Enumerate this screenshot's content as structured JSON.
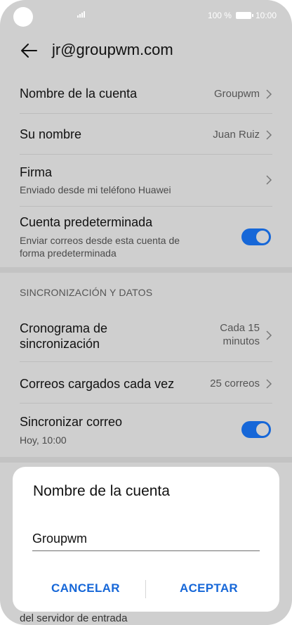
{
  "status_bar": {
    "battery_text": "100 %",
    "time": "10:00"
  },
  "header": {
    "title": "jr@groupwm.com",
    "back_icon": "arrow-left-icon"
  },
  "settings": {
    "account_name": {
      "label": "Nombre de la cuenta",
      "value": "Groupwm"
    },
    "your_name": {
      "label": "Su nombre",
      "value": "Juan Ruiz"
    },
    "signature": {
      "label": "Firma",
      "sub": "Enviado desde mi teléfono Huawei"
    },
    "default_account": {
      "label": "Cuenta predeterminada",
      "sub_line1": "Enviar correos desde esta cuenta de",
      "sub_line2": "forma predeterminada",
      "enabled": true
    }
  },
  "sync_section": {
    "heading": "SINCRONIZACIÓN Y DATOS",
    "schedule": {
      "label_line1": "Cronograma de",
      "label_line2": "sincronización",
      "value_line1": "Cada 15",
      "value_line2": "minutos"
    },
    "loaded": {
      "label": "Correos cargados cada vez",
      "value": "25 correos"
    },
    "sync_mail": {
      "label": "Sincronizar correo",
      "sub": "Hoy, 10:00",
      "enabled": true
    }
  },
  "partial_bottom_text": "del servidor de entrada",
  "dialog": {
    "title": "Nombre de la cuenta",
    "input_value": "Groupwm",
    "cancel_label": "CANCELAR",
    "accept_label": "ACEPTAR"
  },
  "colors": {
    "accent": "#1667d8",
    "background": "#cfcfcf",
    "dialog": "#ffffff"
  }
}
